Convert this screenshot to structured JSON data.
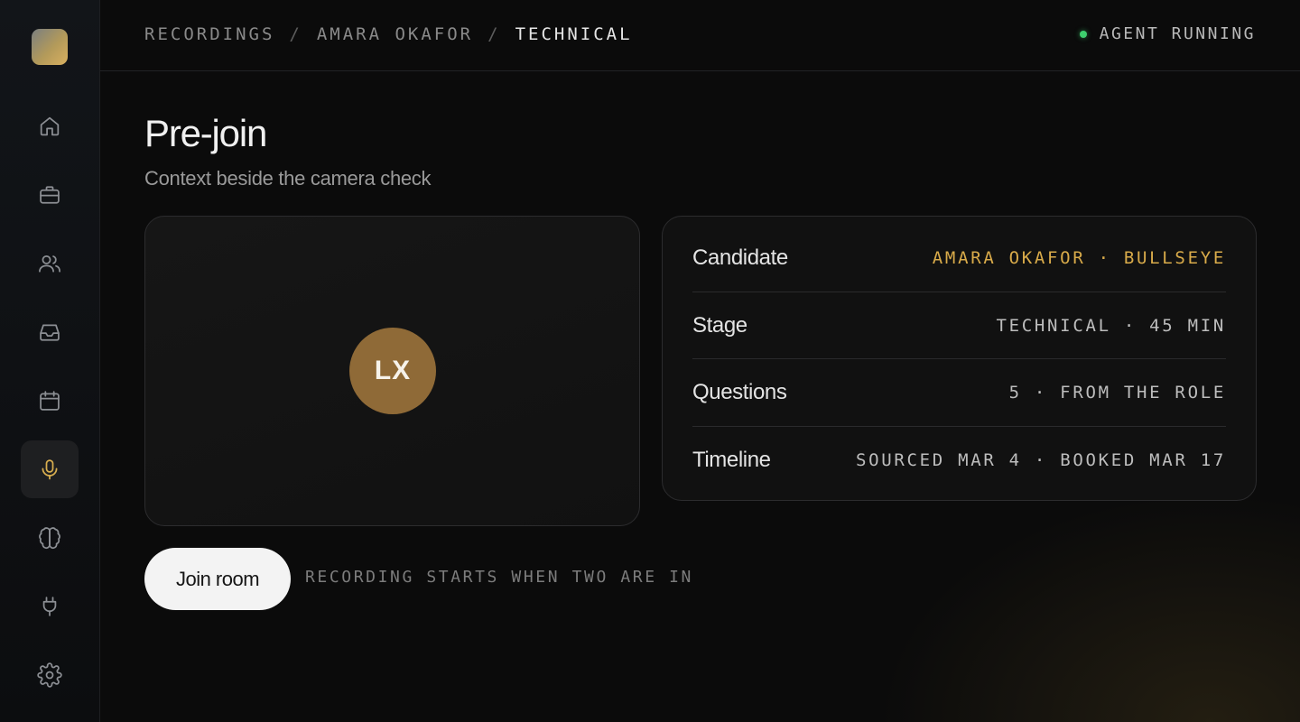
{
  "breadcrumb": {
    "items": [
      "RECORDINGS",
      "AMARA OKAFOR",
      "TECHNICAL"
    ],
    "separator": "/"
  },
  "status": {
    "label": "AGENT RUNNING",
    "color": "#3ecf6e"
  },
  "sidebar": {
    "items": [
      {
        "icon": "home-icon",
        "active": false
      },
      {
        "icon": "briefcase-icon",
        "active": false
      },
      {
        "icon": "users-icon",
        "active": false
      },
      {
        "icon": "inbox-icon",
        "active": false
      },
      {
        "icon": "calendar-icon",
        "active": false
      },
      {
        "icon": "microphone-icon",
        "active": true
      },
      {
        "icon": "brain-icon",
        "active": false
      },
      {
        "icon": "plug-icon",
        "active": false
      },
      {
        "icon": "gear-icon",
        "active": false
      }
    ]
  },
  "page": {
    "title": "Pre-join",
    "subtitle": "Context beside the camera check"
  },
  "camera": {
    "initials": "LX"
  },
  "details": [
    {
      "label": "Candidate",
      "value": "AMARA OKAFOR · BULLSEYE"
    },
    {
      "label": "Stage",
      "value": "TECHNICAL · 45 MIN"
    },
    {
      "label": "Questions",
      "value": "5 · FROM THE ROLE"
    },
    {
      "label": "Timeline",
      "value": "SOURCED MAR 4 · BOOKED MAR 17"
    }
  ],
  "actions": {
    "join_label": "Join room",
    "hint": "RECORDING STARTS WHEN TWO ARE IN"
  },
  "colors": {
    "accent": "#d9ab4a",
    "avatar": "#8f6a37",
    "background": "#0b0b0b"
  }
}
